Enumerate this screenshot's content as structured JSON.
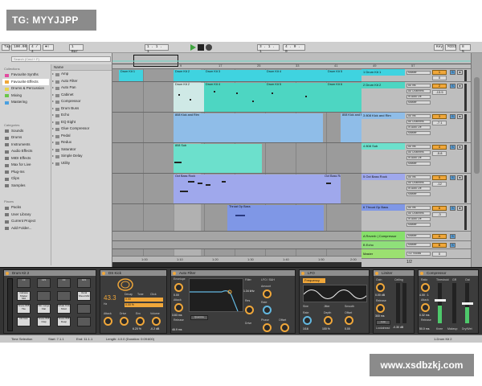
{
  "watermark_top": "TG: MYYJJPP",
  "watermark_bottom": "www.xsdbzkj.com",
  "transport": {
    "tap": "Tap",
    "tempo": "100.00",
    "time_sig": "4 / 4",
    "metronome": "●○",
    "quant": "1 Bar",
    "position": "1 . 1 . 1",
    "loop_start": "3 . 1 . 1",
    "loop_len": "4 . 0 . 0",
    "key": "Key",
    "midi": "MIDI",
    "cpu": "8 %"
  },
  "browser": {
    "search_placeholder": "Search (Cmd + F)",
    "collections_header": "Collections",
    "collections": [
      "Favourite Synths",
      "Favourite Effects",
      "Drums & Percussion",
      "Mixing",
      "Mastering"
    ],
    "categories_header": "Categories",
    "categories": [
      "Sounds",
      "Drums",
      "Instruments",
      "Audio Effects",
      "MIDI Effects",
      "Max for Live",
      "Plug-Ins",
      "Clips",
      "Samples"
    ],
    "places_header": "Places",
    "places": [
      "Packs",
      "User Library",
      "Current Project",
      "Add Folder..."
    ],
    "name_header": "Name",
    "items": [
      "Amp",
      "Auto Filter",
      "Auto Pan",
      "Cabinet",
      "Compressor",
      "Drum Buss",
      "Echo",
      "EQ Eight",
      "Glue Compressor",
      "Pedal",
      "Redux",
      "Saturator",
      "Simple Delay",
      "Utility"
    ]
  },
  "ruler_labels": [
    "9",
    "17",
    "25",
    "33",
    "41",
    "49",
    "57"
  ],
  "bottom_ruler": [
    "1:00",
    "1:10",
    "1:20",
    "1:30",
    "1:40",
    "1:50",
    "2:00"
  ],
  "clips": {
    "lane1": [
      "Drum Kit 1",
      "Drum Kit 2",
      "Drum Kit 3",
      "Drum Kit 4",
      "Drum Kit 5"
    ],
    "lane2": [
      "Drum Kit 2",
      "Drum Kit 4",
      "Drum Kit 5",
      "Drum Kit 6"
    ],
    "lane3": [
      "808 Kick and Rim",
      "808 Kick and Rim"
    ],
    "lane4": "808 Sub",
    "lane5": [
      "Oct Bass Rock",
      "Oct Bass Rock"
    ],
    "lane6": "Throat Op Bass"
  },
  "tracks": [
    {
      "name": "1 Drum Kit 1",
      "num": "1",
      "val": "0",
      "io1": "Master",
      "io2": "All Ins",
      "color": "#3fd3e0"
    },
    {
      "name": "2 Drum Kit 2",
      "num": "2",
      "val": "-13.5",
      "io1": "All Ins",
      "io2": "All Channels",
      "color": "#4dd6c2"
    },
    {
      "name": "3 808 Kick and Rim",
      "num": "3",
      "val": "-7.1",
      "io1": "All Ins",
      "io2": "All Channels",
      "color": "#8fbde8"
    },
    {
      "name": "4 808 Sub",
      "num": "4",
      "val": "-5.8",
      "io1": "All Ins",
      "io2": "All Channels",
      "color": "#6ce0cc"
    },
    {
      "name": "5 Oct Bass Rock",
      "num": "5",
      "val": "-12",
      "io1": "All Ins",
      "io2": "All Channels",
      "color": "#9fa8ec"
    },
    {
      "name": "6 Throat Op Bass",
      "num": "6",
      "val": "-3",
      "io1": "All Ins",
      "io2": "All Channels",
      "color": "#7f97e6"
    }
  ],
  "returns": [
    {
      "name": "A Reverb | Compressor",
      "num": "A",
      "color": "#86e06a"
    },
    {
      "name": "B Echo",
      "num": "B",
      "color": "#8fe07a"
    },
    {
      "name": "Master",
      "num": "0",
      "color": "#9be070"
    }
  ],
  "master_io": "1/2",
  "cue_label": "1/2 Vocals",
  "devices": {
    "drum_rack": {
      "title": "Drum Kit 2",
      "pads": [
        "C3",
        "C#3",
        "D3",
        "D#3",
        "Cabasa Shaker Mid",
        "",
        "",
        "Vocal Shout Mid",
        "Snare 808 Tite",
        "Rim Large Flat",
        "Inhale Kick Short",
        "",
        "D3 Kick",
        "Snare 808 Clap",
        "Snare 808 Deep",
        ""
      ]
    },
    "kick": {
      "title": "DS Kick",
      "pitch": "43.3",
      "pitch_unit": "Hz",
      "decay": "Decay",
      "tone": "Tone",
      "click": "Click",
      "attack": "Attack",
      "drive": "Drive",
      "env": "Env",
      "volume": "Volume",
      "v1": "0.00",
      "v2": "0.00 %",
      "v3": "6.20 %",
      "v4": "-0.2 dB"
    },
    "filter": {
      "title": "Auto Filter",
      "envelope": "Envelope",
      "filter": "Filter",
      "lfo": "LFO / S&H",
      "amount": "Amount",
      "attack": "Attack",
      "release": "Release",
      "freq": "1.34 kHz",
      "res": "Res",
      "quantize": "Quantize",
      "drive": "Drive",
      "rate": "Rate",
      "phase": "Phase",
      "offset": "Offset",
      "env_amt": "0.00",
      "att_val": "3.83 ms",
      "rel_val": "46.9 ms"
    },
    "lfo": {
      "title": "LFO",
      "param": "Frequency",
      "rate": "Rate",
      "depth": "Depth",
      "offset": "Offset",
      "shape": "Shape",
      "rate_val": "1/16",
      "depth_val": "100 %",
      "off_val": "0.00",
      "jitter": "Jitter",
      "smooth": "Smooth",
      "sine": "Sine"
    },
    "limiter": {
      "title": "Limiter",
      "gain": "Gain",
      "ceiling": "Ceiling",
      "release": "Release",
      "lookahead": "Lookahead",
      "gain_val": "0.00 dB",
      "ceil_val": "-0.30 dB",
      "rel_val": "300 ms",
      "auto": "Auto"
    },
    "comp": {
      "title": "Compressor",
      "ratio": "Ratio",
      "attack": "Attack",
      "release": "Release",
      "threshold": "Threshold",
      "gr": "GR",
      "out": "Out",
      "ratio_val": "4.00 : 1",
      "att_val": "0.32 ms",
      "rel_val": "50.0 ms",
      "knee": "Knee",
      "makeup": "Makeup",
      "dry_wet": "Dry/Wet"
    }
  },
  "status": {
    "left": "Time Selection",
    "start": "Start: 7.1.1",
    "end": "End: 11.1.1",
    "length": "Length: 4.0.0 (Duration: 0:09:600)",
    "right": "1-Drum Kit 2"
  },
  "colors": {
    "accent": "#f0a73a",
    "cyan": "#3fd3e0",
    "teal": "#4dd6c2",
    "blue_light": "#8fbde8",
    "periwinkle": "#9fa8ec",
    "blue": "#7f97e6",
    "green": "#86e06a"
  }
}
